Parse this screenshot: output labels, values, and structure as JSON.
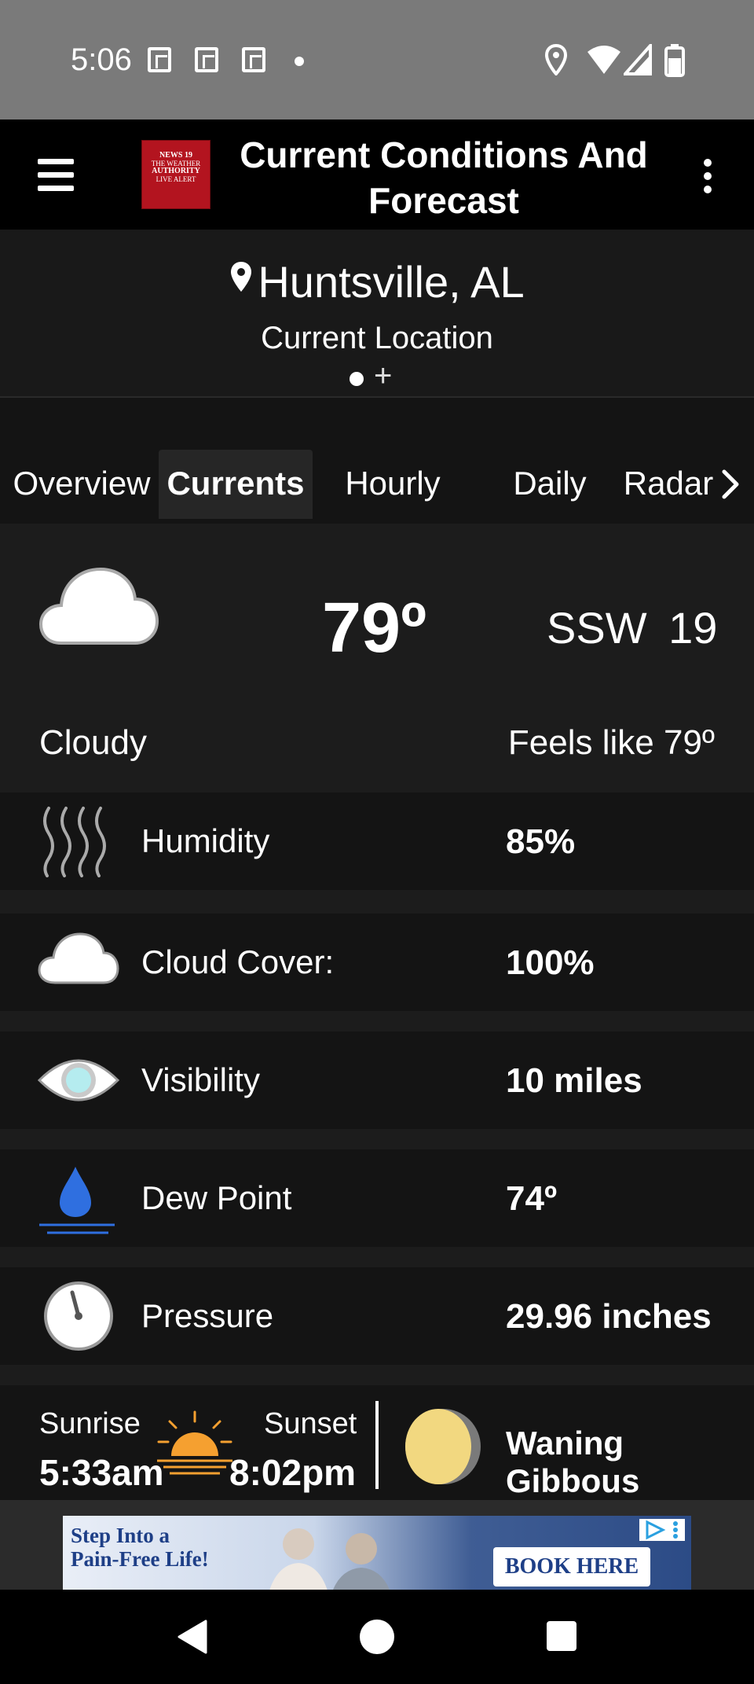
{
  "status_bar": {
    "time": "5:06",
    "icons": [
      "notification-icon",
      "notification-icon",
      "notification-icon",
      "dot-icon",
      "location-icon",
      "wifi-icon",
      "signal-icon",
      "battery-icon"
    ]
  },
  "app_bar": {
    "title": "Current Conditions And Forecast",
    "logo_lines": [
      "NEWS 19",
      "THE WEATHER",
      "AUTHORITY",
      "LIVE ALERT"
    ]
  },
  "location": {
    "name": "Huntsville, AL",
    "subtitle": "Current Location",
    "add_symbol": "+"
  },
  "tabs": [
    {
      "label": "Overview",
      "active": false
    },
    {
      "label": "Currents",
      "active": true
    },
    {
      "label": "Hourly",
      "active": false
    },
    {
      "label": "Daily",
      "active": false
    },
    {
      "label": "Radar",
      "active": false
    }
  ],
  "current": {
    "temperature": "79º",
    "wind": "SSW 19",
    "condition": "Cloudy",
    "feels_like": "Feels like 79º"
  },
  "details": [
    {
      "icon": "humidity-icon",
      "label": "Humidity",
      "value": "85%"
    },
    {
      "icon": "cloud-icon",
      "label": "Cloud Cover:",
      "value": "100%"
    },
    {
      "icon": "eye-icon",
      "label": "Visibility",
      "value": "10 miles"
    },
    {
      "icon": "dew-drop-icon",
      "label": "Dew Point",
      "value": "74º"
    },
    {
      "icon": "pressure-gauge-icon",
      "label": "Pressure",
      "value": "29.96 inches"
    }
  ],
  "sun": {
    "sunrise_label": "Sunrise",
    "sunrise_time": "5:33am",
    "sunset_label": "Sunset",
    "sunset_time": "8:02pm"
  },
  "moon": {
    "phase": "Waning Gibbous"
  },
  "ad": {
    "headline_1": "Step Into a",
    "headline_2": "Pain-Free Life!",
    "cta": "BOOK HERE"
  },
  "colors": {
    "app_bar_bg": "#000000",
    "panel_bg": "#1c1c1c",
    "row_bg": "#141414",
    "dew_blue": "#2f6fe0",
    "sun_orange": "#f5a030",
    "moon_yellow": "#f2d880",
    "logo_red": "#b3141f"
  }
}
